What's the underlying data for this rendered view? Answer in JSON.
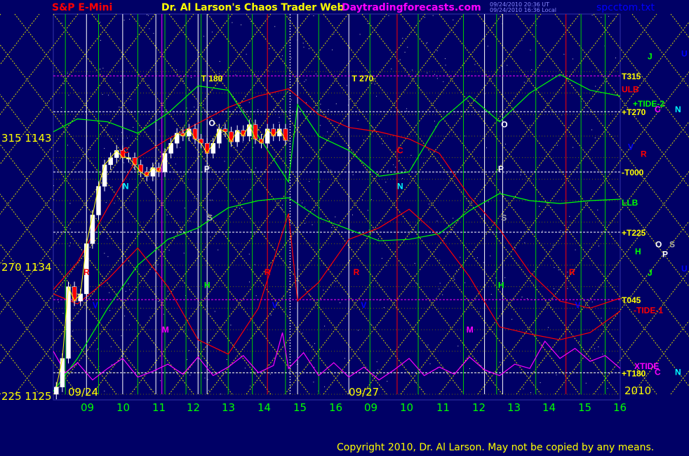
{
  "header": {
    "symbol": "S&P E-Mini",
    "title": "Dr. Al Larson's Chaos Trader Web",
    "site": "Daytradingforecasts.com",
    "stamp1": "09/24/2010 20:36 UT",
    "stamp2": "09/24/2010 16:36 Local",
    "file": "spcctom.txt"
  },
  "footer": {
    "copyright": "Copyright 2010, Dr. Al Larson. May not be copied by any means.",
    "year": "2010"
  },
  "colors": {
    "background": "#000066",
    "yellow": "#ffff00",
    "green": "#00ff00",
    "red": "#ff0000",
    "magenta": "#ff00ff",
    "cyan": "#00ffff",
    "blue": "#0000ff",
    "white": "#ffffff"
  },
  "chart_data": {
    "type": "candlestick",
    "y_axis": {
      "range": [
        1125,
        1148.5
      ],
      "ticks": [
        {
          "label": "315  1143",
          "value": 1143
        },
        {
          "label": "270  1134",
          "value": 1134
        },
        {
          "label": "225  1125",
          "value": 1125
        }
      ]
    },
    "x_axis": {
      "tick_labels": [
        "09",
        "10",
        "11",
        "12",
        "13",
        "14",
        "15",
        "16",
        "09",
        "10",
        "11",
        "12",
        "13",
        "14",
        "15",
        "16"
      ],
      "date_labels": [
        "09/24",
        "09/27"
      ]
    },
    "price_series": {
      "name": "S&P E-Mini 09/24",
      "hours": [
        8.3,
        8.5,
        8.7,
        8.9,
        9.1,
        9.3,
        9.5,
        9.7,
        9.9,
        10.1,
        10.3,
        10.5,
        10.7,
        10.9,
        11.1,
        11.3,
        11.5,
        11.7,
        11.9,
        12.1,
        12.3,
        12.5,
        12.7,
        12.9,
        13.1,
        13.3,
        13.5,
        13.7,
        13.9,
        14.1,
        14.3,
        14.5,
        14.7,
        14.9,
        15.1,
        15.3,
        15.5,
        15.7,
        15.9
      ],
      "prices": [
        1125.5,
        1127.5,
        1132.5,
        1131.5,
        1132.0,
        1135.5,
        1137.5,
        1139.5,
        1141.0,
        1141.5,
        1142.0,
        1141.5,
        1141.5,
        1141.0,
        1140.5,
        1140.2,
        1140.8,
        1140.5,
        1141.8,
        1142.5,
        1143.2,
        1143.0,
        1143.5,
        1142.8,
        1142.5,
        1141.8,
        1142.5,
        1143.5,
        1143.3,
        1142.6,
        1143.4,
        1143.0,
        1143.8,
        1142.8,
        1142.5,
        1143.5,
        1143.0,
        1143.5,
        1142.7
      ]
    },
    "forecast_lines": [
      {
        "name": "ULB",
        "color": "#ff0000",
        "label_value": 1146.3,
        "points": [
          [
            8.2,
            1132.3
          ],
          [
            9.0,
            1134.2
          ],
          [
            10.0,
            1138.0
          ],
          [
            11.0,
            1141.5
          ],
          [
            12.0,
            1142.8
          ],
          [
            13.0,
            1143.9
          ],
          [
            14.0,
            1145.0
          ],
          [
            15.0,
            1145.8
          ],
          [
            16.0,
            1146.3
          ],
          [
            17.0,
            1144.5
          ],
          [
            18.0,
            1143.6
          ],
          [
            19.0,
            1143.3
          ],
          [
            20.0,
            1142.8
          ],
          [
            21.0,
            1141.8
          ],
          [
            22.0,
            1138.8
          ],
          [
            23.0,
            1136.5
          ],
          [
            24.0,
            1133.5
          ],
          [
            25.0,
            1131.5
          ],
          [
            26.0,
            1131.0
          ],
          [
            27.0,
            1131.7
          ]
        ]
      },
      {
        "name": "LLB",
        "color": "#00ff00",
        "label_value": 1138.4,
        "points": [
          [
            8.2,
            1125.2
          ],
          [
            9.0,
            1127.5
          ],
          [
            10.0,
            1131.0
          ],
          [
            11.0,
            1134.0
          ],
          [
            12.0,
            1135.8
          ],
          [
            13.0,
            1136.6
          ],
          [
            14.0,
            1138.0
          ],
          [
            15.0,
            1138.5
          ],
          [
            16.0,
            1138.7
          ],
          [
            17.0,
            1137.3
          ],
          [
            18.0,
            1136.5
          ],
          [
            19.0,
            1135.7
          ],
          [
            20.0,
            1135.8
          ],
          [
            21.0,
            1136.2
          ],
          [
            22.0,
            1137.8
          ],
          [
            23.0,
            1139.0
          ],
          [
            24.0,
            1138.5
          ],
          [
            25.0,
            1138.3
          ],
          [
            26.0,
            1138.5
          ],
          [
            27.0,
            1138.6
          ]
        ]
      },
      {
        "name": "+TIDE-2",
        "color": "#00ff00",
        "label_value": 1145.7,
        "points": [
          [
            8.2,
            1143.3
          ],
          [
            9.0,
            1144.2
          ],
          [
            10.0,
            1144.0
          ],
          [
            11.0,
            1143.2
          ],
          [
            12.0,
            1144.6
          ],
          [
            13.0,
            1146.5
          ],
          [
            14.0,
            1146.2
          ],
          [
            15.0,
            1143.0
          ],
          [
            16.0,
            1139.8
          ],
          [
            16.3,
            1145.2
          ],
          [
            17.0,
            1143.0
          ],
          [
            18.0,
            1142.0
          ],
          [
            19.0,
            1140.2
          ],
          [
            20.0,
            1140.5
          ],
          [
            21.0,
            1144.0
          ],
          [
            22.0,
            1145.8
          ],
          [
            23.0,
            1144.0
          ],
          [
            24.0,
            1146.0
          ],
          [
            25.0,
            1147.3
          ],
          [
            26.0,
            1146.2
          ],
          [
            27.0,
            1145.8
          ]
        ]
      },
      {
        "name": "-TIDE-1",
        "color": "#ff0000",
        "label_value": 1131.0,
        "points": [
          [
            8.2,
            1132.0
          ],
          [
            9.0,
            1131.3
          ],
          [
            10.0,
            1133.0
          ],
          [
            11.0,
            1135.2
          ],
          [
            12.0,
            1132.5
          ],
          [
            13.0,
            1128.8
          ],
          [
            14.0,
            1127.8
          ],
          [
            15.0,
            1131.0
          ],
          [
            16.0,
            1137.6
          ],
          [
            16.3,
            1131.5
          ],
          [
            17.0,
            1132.8
          ],
          [
            18.0,
            1135.8
          ],
          [
            19.0,
            1136.6
          ],
          [
            20.0,
            1137.9
          ],
          [
            21.0,
            1136.0
          ],
          [
            22.0,
            1133.2
          ],
          [
            23.0,
            1129.7
          ],
          [
            24.0,
            1129.2
          ],
          [
            25.0,
            1128.8
          ],
          [
            26.0,
            1129.3
          ],
          [
            27.0,
            1130.8
          ]
        ]
      },
      {
        "name": "XTIDE",
        "color": "#ff00ff",
        "label_value": 1127.0,
        "points": [
          [
            8.2,
            1128.0
          ],
          [
            8.6,
            1126.5
          ],
          [
            9.0,
            1127.2
          ],
          [
            9.5,
            1126.0
          ],
          [
            10.0,
            1126.8
          ],
          [
            10.5,
            1127.5
          ],
          [
            11.0,
            1126.2
          ],
          [
            11.5,
            1126.6
          ],
          [
            12.0,
            1127.1
          ],
          [
            12.5,
            1126.4
          ],
          [
            13.0,
            1127.6
          ],
          [
            13.5,
            1126.3
          ],
          [
            14.0,
            1126.9
          ],
          [
            14.5,
            1127.7
          ],
          [
            15.0,
            1126.5
          ],
          [
            15.5,
            1127.0
          ],
          [
            15.8,
            1129.3
          ],
          [
            16.0,
            1126.8
          ],
          [
            16.5,
            1127.9
          ],
          [
            17.0,
            1126.3
          ],
          [
            17.5,
            1127.2
          ],
          [
            18.0,
            1126.2
          ],
          [
            18.5,
            1126.9
          ],
          [
            19.0,
            1126.0
          ],
          [
            19.5,
            1126.7
          ],
          [
            20.0,
            1127.5
          ],
          [
            20.5,
            1126.3
          ],
          [
            21.0,
            1126.9
          ],
          [
            21.5,
            1126.4
          ],
          [
            22.0,
            1127.6
          ],
          [
            22.5,
            1126.7
          ],
          [
            23.0,
            1126.3
          ],
          [
            23.5,
            1127.1
          ],
          [
            24.0,
            1126.8
          ],
          [
            24.5,
            1128.7
          ],
          [
            25.0,
            1127.5
          ],
          [
            25.5,
            1128.2
          ],
          [
            26.0,
            1127.3
          ],
          [
            26.5,
            1127.7
          ],
          [
            27.0,
            1126.8
          ]
        ]
      }
    ],
    "horizontal_levels": [
      {
        "label": "T315",
        "value": 1147.2,
        "color": "#ff00ff"
      },
      {
        "label": "+T270",
        "value": 1144.7,
        "color": "#ffffff"
      },
      {
        "label": "-T000",
        "value": 1140.5,
        "color": "#ffffff"
      },
      {
        "label": "+T225",
        "value": 1136.3,
        "color": "#ffffff"
      },
      {
        "label": "T045",
        "value": 1131.6,
        "color": "#ff00ff"
      },
      {
        "label": "+T180",
        "value": 1126.5,
        "color": "#ffffff"
      }
    ],
    "right_labels": [
      {
        "text": "J",
        "color": "#00ff00",
        "value": 1148.6
      },
      {
        "text": "U",
        "color": "#0000ff",
        "value": 1148.8
      },
      {
        "text": "T315",
        "color": "#ffff00",
        "value": 1147.2
      },
      {
        "text": "ULB",
        "color": "#ff0000",
        "value": 1146.3
      },
      {
        "text": "+TIDE-2",
        "color": "#00ff00",
        "value": 1145.3
      },
      {
        "text": "C",
        "color": "#ff00ff",
        "value": 1144.9
      },
      {
        "text": "N",
        "color": "#00ffff",
        "value": 1144.9
      },
      {
        "text": "+T270",
        "color": "#ffff00",
        "value": 1144.7
      },
      {
        "text": "V",
        "color": "#0000ff",
        "value": 1142.3
      },
      {
        "text": "R",
        "color": "#ff0000",
        "value": 1141.8
      },
      {
        "text": "-T000",
        "color": "#ffff00",
        "value": 1140.5
      },
      {
        "text": "LLB",
        "color": "#00ff00",
        "value": 1138.4
      },
      {
        "text": "+T225",
        "color": "#ffff00",
        "value": 1136.3
      },
      {
        "text": "O",
        "color": "#ffffff",
        "value": 1135.5
      },
      {
        "text": "S",
        "color": "#aaaaaa",
        "value": 1135.5
      },
      {
        "text": "H",
        "color": "#00ff00",
        "value": 1135.0
      },
      {
        "text": "P",
        "color": "#ffffff",
        "value": 1134.8
      },
      {
        "text": "U",
        "color": "#0000ff",
        "value": 1133.8
      },
      {
        "text": "J",
        "color": "#00ff00",
        "value": 1133.5
      },
      {
        "text": "T045",
        "color": "#ffff00",
        "value": 1131.6
      },
      {
        "text": "-TIDE-1",
        "color": "#ff0000",
        "value": 1130.9
      },
      {
        "text": "XTIDE",
        "color": "#ff00ff",
        "value": 1127.0
      },
      {
        "text": "C",
        "color": "#ff00ff",
        "value": 1126.6
      },
      {
        "text": "N",
        "color": "#00ffff",
        "value": 1126.6
      },
      {
        "text": "+T180",
        "color": "#ffff00",
        "value": 1126.5
      }
    ],
    "cycle_labels": [
      {
        "text": "T   180",
        "color": "#ffff00",
        "hour": 13.1,
        "value": 1147.0
      },
      {
        "text": "T   270",
        "color": "#ffff00",
        "hour": 18.1,
        "value": 1147.0
      },
      {
        "text": "C",
        "color": "#ff0000",
        "hour": 10.5,
        "value": 1142.0
      },
      {
        "text": "N",
        "color": "#00ffff",
        "hour": 10.5,
        "value": 1139.5
      },
      {
        "text": "O",
        "color": "#ffffff",
        "hour": 13.35,
        "value": 1143.9
      },
      {
        "text": "P",
        "color": "#ffffff",
        "hour": 13.2,
        "value": 1140.7
      },
      {
        "text": "S",
        "color": "#aaaaaa",
        "hour": 13.3,
        "value": 1137.3
      },
      {
        "text": "H",
        "color": "#00ff00",
        "hour": 13.2,
        "value": 1132.6
      },
      {
        "text": "M",
        "color": "#ff00ff",
        "hour": 11.8,
        "value": 1129.5
      },
      {
        "text": "V",
        "color": "#0000ff",
        "hour": 15.45,
        "value": 1131.2
      },
      {
        "text": "R",
        "color": "#ff0000",
        "hour": 15.2,
        "value": 1133.5
      },
      {
        "text": "R",
        "color": "#ff0000",
        "hour": 9.2,
        "value": 1133.5
      },
      {
        "text": "V",
        "color": "#0000ff",
        "hour": 9.5,
        "value": 1131.2
      },
      {
        "text": "C",
        "color": "#ff0000",
        "hour": 19.6,
        "value": 1142.0
      },
      {
        "text": "N",
        "color": "#00ffff",
        "hour": 19.6,
        "value": 1139.5
      },
      {
        "text": "O",
        "color": "#ffffff",
        "hour": 23.05,
        "value": 1143.8
      },
      {
        "text": "P",
        "color": "#ffffff",
        "hour": 22.95,
        "value": 1140.7
      },
      {
        "text": "S",
        "color": "#aaaaaa",
        "hour": 23.05,
        "value": 1137.3
      },
      {
        "text": "H",
        "color": "#00ff00",
        "hour": 22.95,
        "value": 1132.6
      },
      {
        "text": "M",
        "color": "#ff00ff",
        "hour": 21.9,
        "value": 1129.5
      },
      {
        "text": "V",
        "color": "#0000ff",
        "hour": 18.4,
        "value": 1131.2
      },
      {
        "text": "R",
        "color": "#ff0000",
        "hour": 18.15,
        "value": 1133.5
      },
      {
        "text": "R",
        "color": "#ff0000",
        "hour": 25.3,
        "value": 1133.5
      },
      {
        "text": "V",
        "color": "#0000ff",
        "hour": 25.5,
        "value": 1131.2
      }
    ]
  }
}
